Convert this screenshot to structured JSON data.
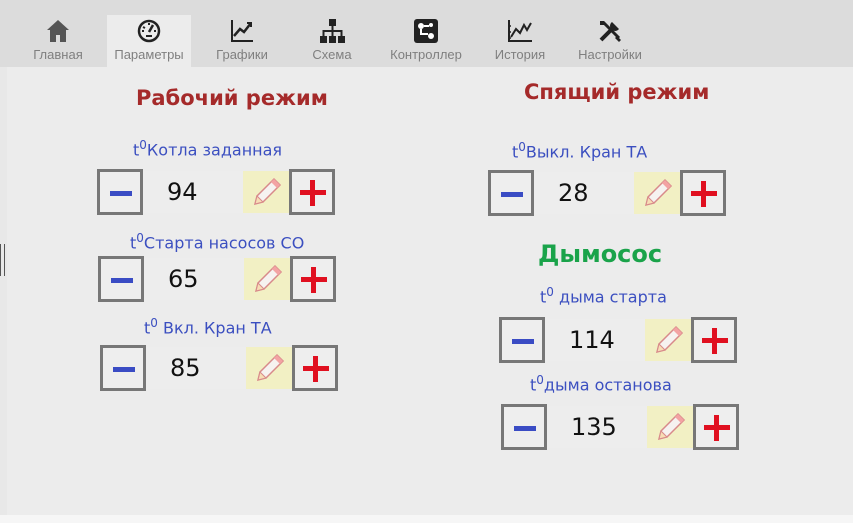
{
  "tabs": [
    {
      "label": "Главная",
      "icon": "home-icon",
      "active": false
    },
    {
      "label": "Параметры",
      "icon": "gauge-icon",
      "active": true
    },
    {
      "label": "Графики",
      "icon": "line-chart-icon",
      "active": false
    },
    {
      "label": "Схема",
      "icon": "hierarchy-icon",
      "active": false
    },
    {
      "label": "Контроллер",
      "icon": "circuit-icon",
      "active": false
    },
    {
      "label": "История",
      "icon": "history-chart-icon",
      "active": false
    },
    {
      "label": "Настройки",
      "icon": "tools-icon",
      "active": false
    }
  ],
  "work_mode": {
    "title": "Рабочий режим",
    "params": [
      {
        "sup": "0",
        "label": "Котла заданная",
        "value": "94"
      },
      {
        "sup": "0",
        "label": "Старта насосов СО",
        "value": "65"
      },
      {
        "sup": "0",
        "label": " Вкл. Кран ТА",
        "value": "85"
      }
    ]
  },
  "sleep_mode": {
    "title": "Спящий режим",
    "params": [
      {
        "sup": "0",
        "label": "Выкл. Кран ТА",
        "value": "28"
      }
    ]
  },
  "fan": {
    "title": "Дымосос",
    "params": [
      {
        "sup": "0",
        "label": " дыма старта",
        "value": "114"
      },
      {
        "sup": "0",
        "label": "дыма останова",
        "value": "135"
      }
    ]
  },
  "colors": {
    "accent_red": "#a52a2a",
    "accent_green": "#1aa34a",
    "label_blue": "#3b4fc0",
    "minus_blue": "#3a4cc4",
    "plus_red": "#e01020",
    "pen_bg": "#f2f0c4"
  },
  "icons": {
    "minus": "minus-icon",
    "plus": "plus-icon",
    "edit": "pencil-icon"
  }
}
